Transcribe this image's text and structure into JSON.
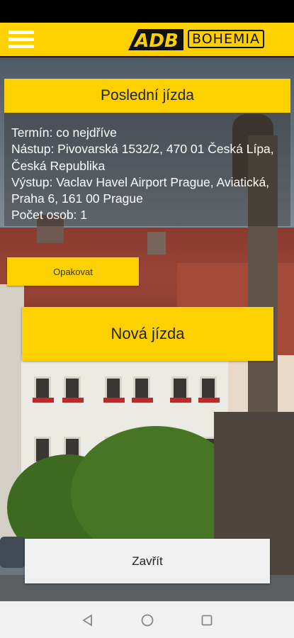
{
  "app_bar": {
    "menu_icon": "hamburger-menu-icon",
    "logo": {
      "brand_left": "ADB",
      "brand_right": "BOHEMIA"
    }
  },
  "last_ride": {
    "title": "Poslední jízda",
    "term": "Termín: co nejdříve",
    "pickup": "Nástup: Pivovarská 1532/2, 470 01 Česká Lípa, Česká Republika",
    "dropoff": "Výstup: Vaclav Havel Airport Prague, Aviatická, Praha 6, 161 00 Prague",
    "passengers": "Počet osob: 1",
    "repeat_label": "Opakovat"
  },
  "new_ride_label": "Nová jízda",
  "close_label": "Zavřít",
  "nav": {
    "back_icon": "back-triangle-icon",
    "home_icon": "home-circle-icon",
    "recents_icon": "recents-square-icon"
  },
  "colors": {
    "accent": "#fdd000",
    "close_bg": "#f0f0f0",
    "nav_bg": "#f2f2f2"
  }
}
